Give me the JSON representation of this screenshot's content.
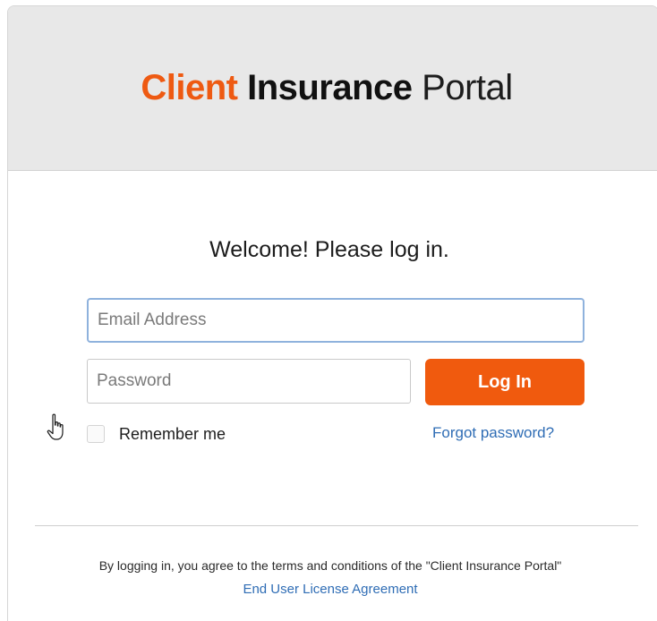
{
  "header": {
    "brand_word1": "Client",
    "brand_word2": "Insurance",
    "brand_word3": "Portal"
  },
  "login": {
    "welcome": "Welcome! Please log in.",
    "email_placeholder": "Email Address",
    "email_value": "",
    "password_placeholder": "Password",
    "password_value": "",
    "login_button": "Log In",
    "remember_label": "Remember me",
    "remember_checked": false,
    "forgot_link": "Forgot password?"
  },
  "footer": {
    "terms_text": "By logging in, you agree to the terms and conditions of the \"Client Insurance Portal\"",
    "eula_link": "End User License Agreement"
  },
  "icons": {
    "cursor": "hand-pointer-icon"
  },
  "colors": {
    "brand_orange": "#ee5a12",
    "button_orange": "#f05a0e",
    "link_blue": "#2f6db5",
    "header_bg": "#e8e8e8",
    "focus_border": "#8fb2dd"
  }
}
